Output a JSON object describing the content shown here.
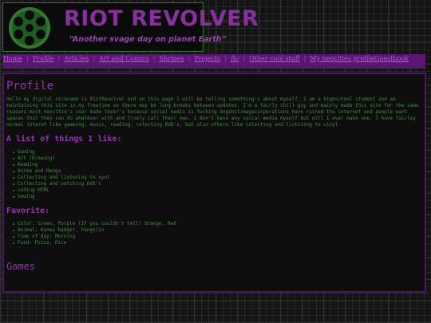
{
  "header": {
    "title": "RIOT REVOLVER",
    "tagline": "“Another svage day on planet Earth”",
    "logo_icon": "revolver-cylinder-icon",
    "colors": {
      "title": "#8a2fa0",
      "logo": "#2f7a2f",
      "accent": "#5a1670"
    }
  },
  "nav": {
    "items": [
      "Home",
      "Profile",
      "Articles",
      "Art and Comics",
      "Shrines",
      "Projects",
      "/b/",
      "Other cool stuff",
      "My neocities profile",
      "Guestbook"
    ]
  },
  "main": {
    "page_title": "Profile",
    "intro": "Hello my digital nickname is RiotRevolver and on this page I will be telling something's about myself, I am a highschool student and am maintaining this site in my freetime so there may be long breaks between updates. I'm a fairly chill guy and mainly made this site for the same reasons most neocitie's user made their's because social media is fucking dogshit/megacorporations have ruined the internet and people want spaces that they can do whatever with and truely call their own. I don't have any social media myself but will I ever make one. I have fairley normal interet like gameing, music, reading, colecting DVD's, but also others like colecting and listining to vinyl.",
    "likes_heading": "A list of things I like:",
    "likes": [
      "Gaming",
      "Art (Drawing)",
      "Reading",
      "Anime and Manga",
      "Collecting and listening to vynl",
      "Collecting and watching DVD's",
      "coding HTML",
      "Sewing"
    ],
    "favorite_heading": "Favorite:",
    "favorites": [
      "Color: Green, Purple (If you couldn't tell) Orange, Red",
      "Animal: Honey badger, Pangolin",
      "Time of day: Morning",
      "Food: Pizza, Rice"
    ],
    "games_heading": "Games"
  }
}
